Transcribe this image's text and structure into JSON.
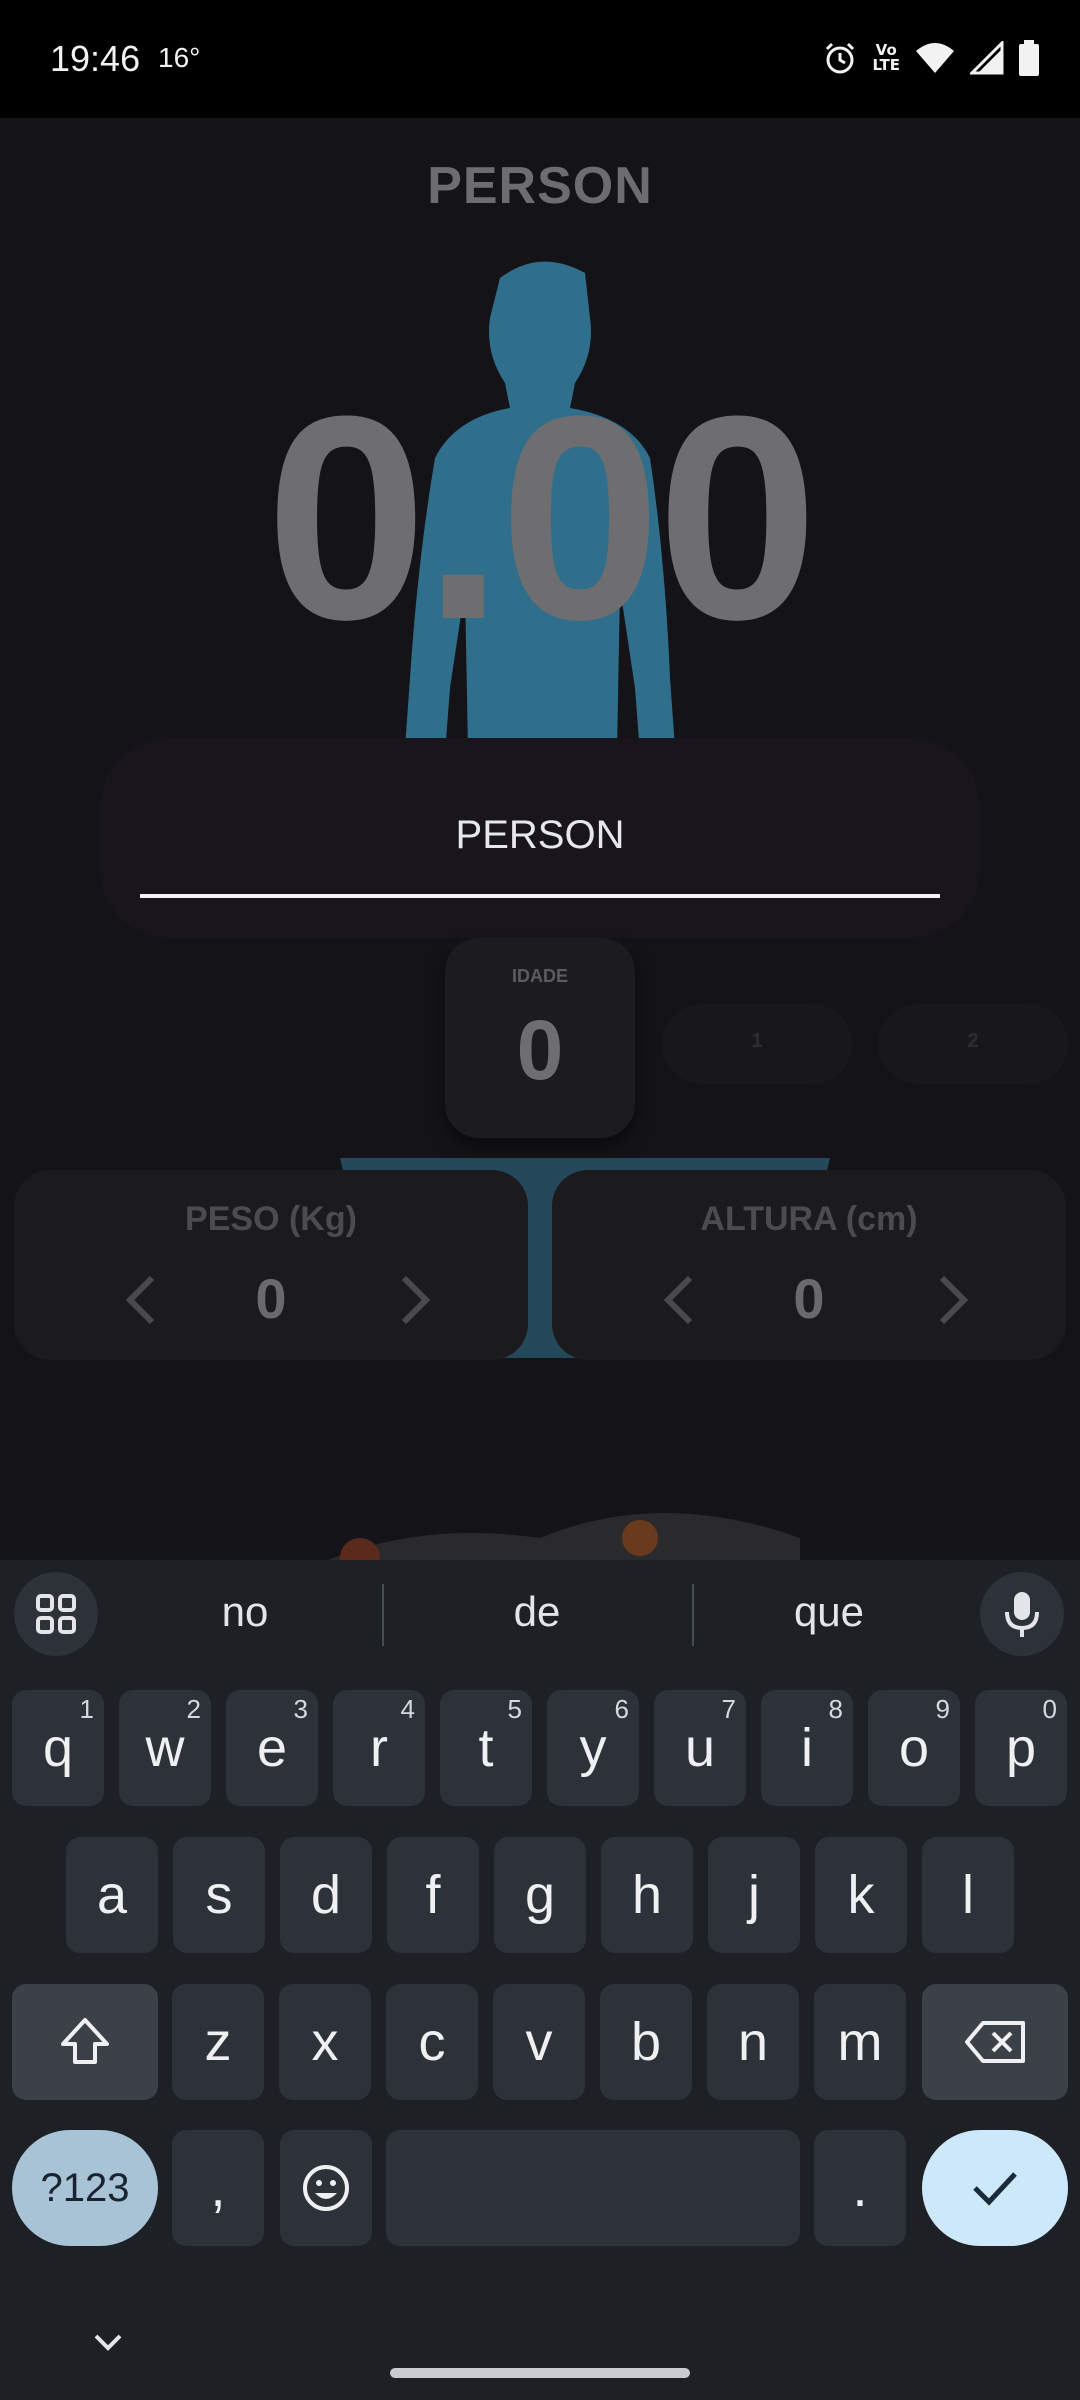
{
  "status": {
    "time": "19:46",
    "temp": "16°",
    "icons": [
      "alarm-icon",
      "volte-icon",
      "wifi-icon",
      "signal-icon",
      "battery-icon"
    ],
    "volte_line1": "Vo",
    "volte_line2": "LTE"
  },
  "app": {
    "title": "PERSON",
    "display_value": "0.00",
    "name_field_value": "PERSON",
    "age_label": "IDADE",
    "age_value": "0",
    "ghost_pills": [
      "1",
      "2"
    ],
    "weight": {
      "label": "PESO (Kg)",
      "value": "0"
    },
    "height": {
      "label": "ALTURA (cm)",
      "value": "0"
    },
    "accent_color": "#2f6f8c"
  },
  "keyboard": {
    "suggestions": [
      "no",
      "de",
      "que"
    ],
    "row1": [
      {
        "k": "q",
        "h": "1"
      },
      {
        "k": "w",
        "h": "2"
      },
      {
        "k": "e",
        "h": "3"
      },
      {
        "k": "r",
        "h": "4"
      },
      {
        "k": "t",
        "h": "5"
      },
      {
        "k": "y",
        "h": "6"
      },
      {
        "k": "u",
        "h": "7"
      },
      {
        "k": "i",
        "h": "8"
      },
      {
        "k": "o",
        "h": "9"
      },
      {
        "k": "p",
        "h": "0"
      }
    ],
    "row2": [
      "a",
      "s",
      "d",
      "f",
      "g",
      "h",
      "j",
      "k",
      "l"
    ],
    "row3": [
      "z",
      "x",
      "c",
      "v",
      "b",
      "n",
      "m"
    ],
    "symbols_label": "?123",
    "comma": ",",
    "period": "."
  }
}
